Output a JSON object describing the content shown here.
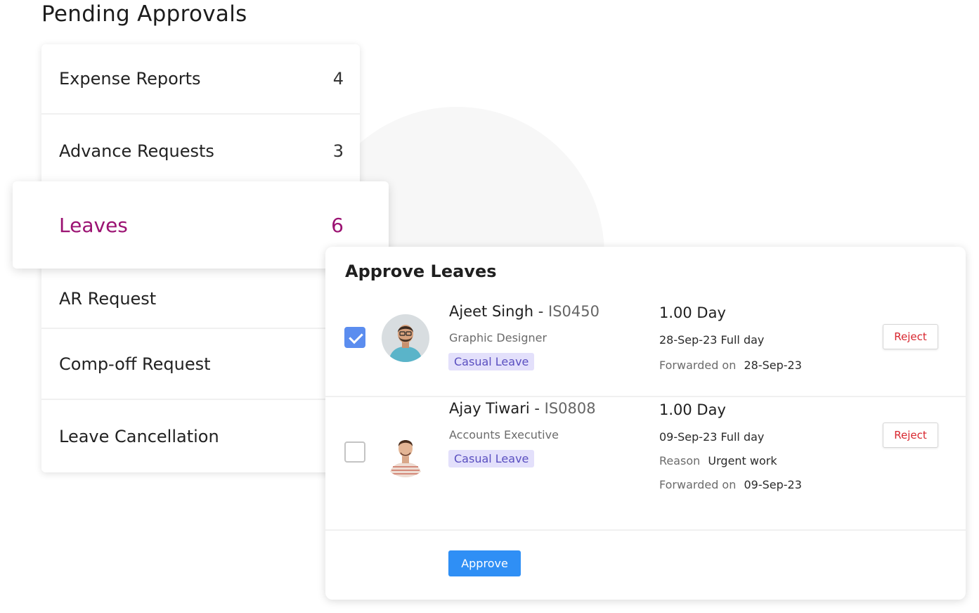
{
  "page": {
    "title": "Pending Approvals"
  },
  "categories": [
    {
      "label": "Expense Reports",
      "count": "4"
    },
    {
      "label": "Advance Requests",
      "count": "3"
    },
    {
      "label": "Leaves",
      "count": "6",
      "active": true
    },
    {
      "label": "AR Request",
      "count": ""
    },
    {
      "label": "Comp-off Request",
      "count": ""
    },
    {
      "label": "Leave Cancellation",
      "count": ""
    }
  ],
  "approve_panel": {
    "title": "Approve Leaves",
    "approve_label": "Approve",
    "requests": [
      {
        "checked": true,
        "name": "Ajeet Singh",
        "separator": "-",
        "emp_code": "IS0450",
        "role": "Graphic Designer",
        "leave_type": "Casual Leave",
        "days": "1.00 Day",
        "date": "28-Sep-23 Full day",
        "reason_label": "",
        "reason": "",
        "forwarded_label": "Forwarded on",
        "forwarded_date": "28-Sep-23",
        "reject_label": "Reject"
      },
      {
        "checked": false,
        "name": "Ajay Tiwari",
        "separator": "-",
        "emp_code": "IS0808",
        "role": "Accounts Executive",
        "leave_type": "Casual Leave",
        "days": "1.00 Day",
        "date": "09-Sep-23 Full day",
        "reason_label": "Reason",
        "reason": "Urgent work",
        "forwarded_label": "Forwarded on",
        "forwarded_date": "09-Sep-23",
        "reject_label": "Reject"
      }
    ]
  },
  "icons": {
    "checkbox_checked": "check-icon"
  },
  "colors": {
    "active": "#9b1272",
    "primary": "#2f8ff5",
    "reject": "#d8262e",
    "tag_bg": "#e3e0fb",
    "tag_text": "#5a4fc0",
    "checkbox": "#5b8def"
  }
}
